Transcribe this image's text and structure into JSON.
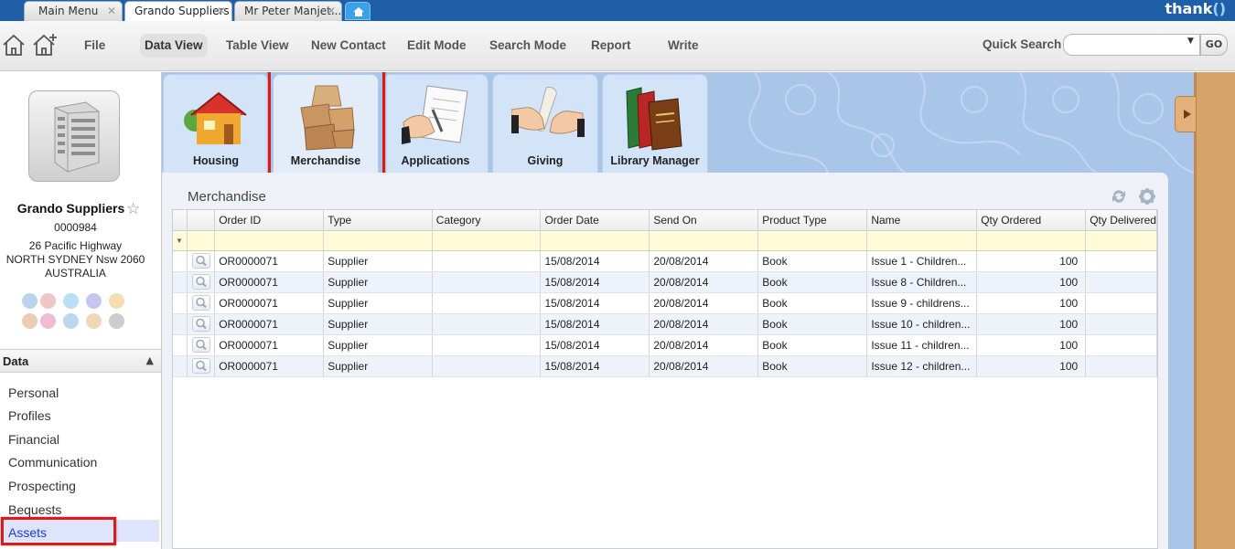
{
  "tabs": [
    {
      "label": "Main Menu"
    },
    {
      "label": "Grando Suppliers"
    },
    {
      "label": "Mr Peter Manjet..."
    }
  ],
  "brand": "thank",
  "toolbar": {
    "menu": [
      "File",
      "Data View",
      "Table View",
      "New Contact",
      "Edit Mode",
      "Search Mode",
      "Report",
      "Write"
    ],
    "active_menu": "Data View",
    "quick_search_label": "Quick Search",
    "quick_search_value": "",
    "go_label": "GO"
  },
  "contact": {
    "name": "Grando Suppliers",
    "id": "0000984",
    "address1": "26 Pacific Highway",
    "address2": "NORTH SYDNEY Nsw 2060",
    "country": "AUSTRALIA"
  },
  "sidebar": {
    "section_title": "Data",
    "items": [
      "Personal",
      "Profiles",
      "Financial",
      "Communication",
      "Prospecting",
      "Bequests",
      "Assets"
    ],
    "selected": "Assets"
  },
  "categories": [
    "Housing",
    "Merchandise",
    "Applications",
    "Giving",
    "Library Manager"
  ],
  "selected_category": "Merchandise",
  "panel": {
    "title": "Merchandise",
    "columns": [
      "Order ID",
      "Type",
      "Category",
      "Order Date",
      "Send On",
      "Product Type",
      "Name",
      "Qty Ordered",
      "Qty Delivered"
    ],
    "rows": [
      [
        "OR0000071",
        "Supplier",
        "",
        "15/08/2014",
        "20/08/2014",
        "Book",
        "Issue 1 - Children...",
        "100",
        ""
      ],
      [
        "OR0000071",
        "Supplier",
        "",
        "15/08/2014",
        "20/08/2014",
        "Book",
        "Issue 8 - Children...",
        "100",
        ""
      ],
      [
        "OR0000071",
        "Supplier",
        "",
        "15/08/2014",
        "20/08/2014",
        "Book",
        "Issue 9 - childrens...",
        "100",
        ""
      ],
      [
        "OR0000071",
        "Supplier",
        "",
        "15/08/2014",
        "20/08/2014",
        "Book",
        "Issue 10 - children...",
        "100",
        ""
      ],
      [
        "OR0000071",
        "Supplier",
        "",
        "15/08/2014",
        "20/08/2014",
        "Book",
        "Issue 11 - children...",
        "100",
        ""
      ],
      [
        "OR0000071",
        "Supplier",
        "",
        "15/08/2014",
        "20/08/2014",
        "Book",
        "Issue 12 - children...",
        "100",
        ""
      ]
    ]
  },
  "colors": {
    "tabstrip": "#1f5fa8",
    "highlight_border": "#e01818",
    "filter_row": "#fffbd8",
    "alt_row": "#eef2fb",
    "selected_nav": "#dde4fb"
  }
}
